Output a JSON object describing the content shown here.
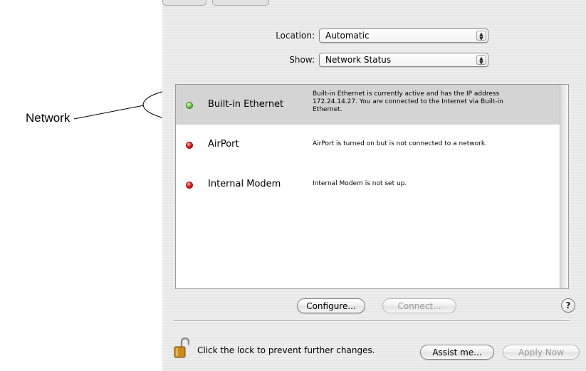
{
  "callout": {
    "label": "Network"
  },
  "location": {
    "label": "Location:",
    "value": "Automatic"
  },
  "show": {
    "label": "Show:",
    "value": "Network Status"
  },
  "services": [
    {
      "name": "Built-in Ethernet",
      "status": "green",
      "selected": true,
      "description": "Built-in Ethernet is currently active and has the IP address 172.24.14.27. You are connected to the Internet via Built-in Ethernet."
    },
    {
      "name": "AirPort",
      "status": "red",
      "selected": false,
      "description": "AirPort is turned on but is not connected to a network."
    },
    {
      "name": "Internal Modem",
      "status": "red",
      "selected": false,
      "description": "Internal Modem is not set up."
    }
  ],
  "buttons": {
    "configure": "Configure...",
    "connect": "Connect...",
    "help": "?",
    "assist": "Assist me...",
    "apply": "Apply Now"
  },
  "lock": {
    "text": "Click the lock to prevent further changes."
  },
  "colors": {
    "status_active": "#3a9a20",
    "status_inactive": "#d10000",
    "selection": "#d4d4d4"
  }
}
